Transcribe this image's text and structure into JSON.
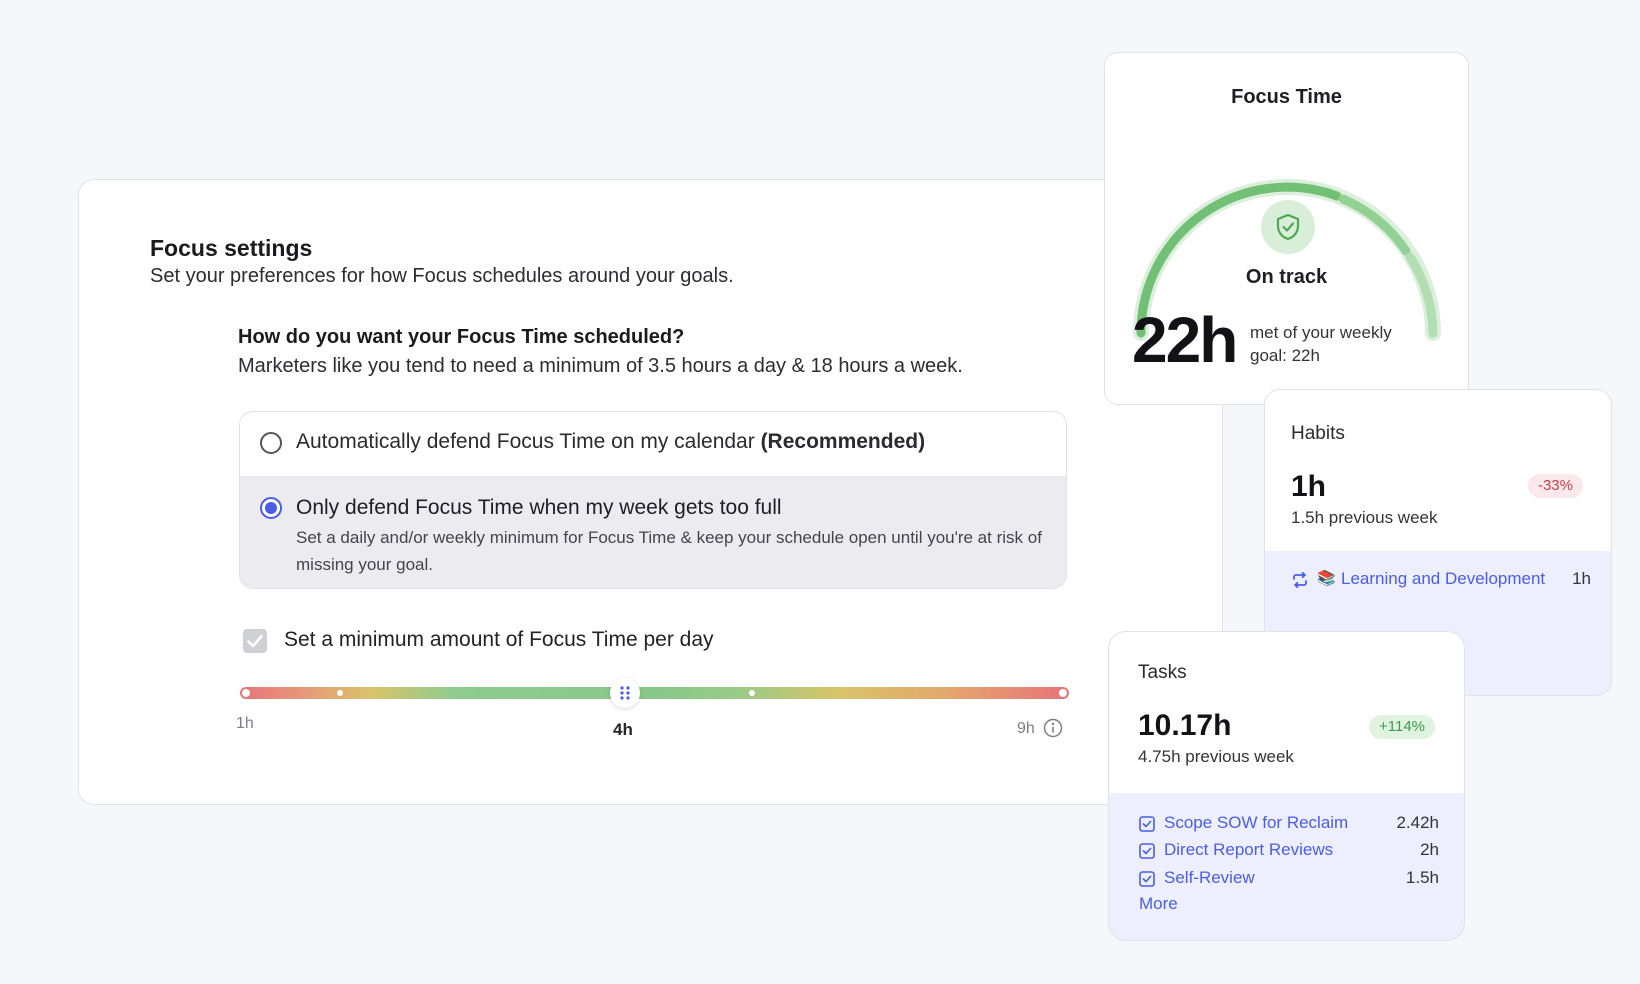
{
  "settings": {
    "title": "Focus settings",
    "subtitle": "Set your preferences for how Focus schedules around your goals.",
    "question": "How do you want your Focus Time scheduled?",
    "question_hint": "Marketers like you tend to need a minimum of 3.5 hours a day & 18 hours a week.",
    "options": [
      {
        "label": "Automatically defend Focus Time on my calendar",
        "tag": "(Recommended)",
        "selected": false
      },
      {
        "label": "Only defend Focus Time when my week gets too full",
        "description": "Set a daily and/or weekly minimum for Focus Time & keep your schedule open until you're at risk of missing your goal.",
        "selected": true
      }
    ],
    "min_checkbox": {
      "label": "Set a minimum amount of Focus Time per day",
      "checked": true
    },
    "slider": {
      "min_label": "1h",
      "value_label": "4h",
      "max_label": "9h",
      "min": 1,
      "max": 9,
      "value": 4
    }
  },
  "focus_time": {
    "title": "Focus Time",
    "status": "On track",
    "hours": "22h",
    "goal_text": "met of your weekly goal: 22h",
    "accent": "#6cc26f"
  },
  "habits": {
    "title": "Habits",
    "hours": "1h",
    "change": "-33%",
    "previous": "1.5h previous week",
    "items": [
      {
        "icon": "repeat-icon",
        "emoji": "📚",
        "name": "Learning and Development",
        "hours": "1h"
      }
    ]
  },
  "tasks": {
    "title": "Tasks",
    "hours": "10.17h",
    "change": "+114%",
    "previous": "4.75h previous week",
    "items": [
      {
        "name": "Scope SOW for Reclaim",
        "hours": "2.42h"
      },
      {
        "name": "Direct Report Reviews",
        "hours": "2h"
      },
      {
        "name": "Self-Review",
        "hours": "1.5h"
      }
    ],
    "more": "More"
  },
  "colors": {
    "link": "#4a5de8",
    "selected_radio": "#4a5de8",
    "panel_tint": "#edefff"
  }
}
